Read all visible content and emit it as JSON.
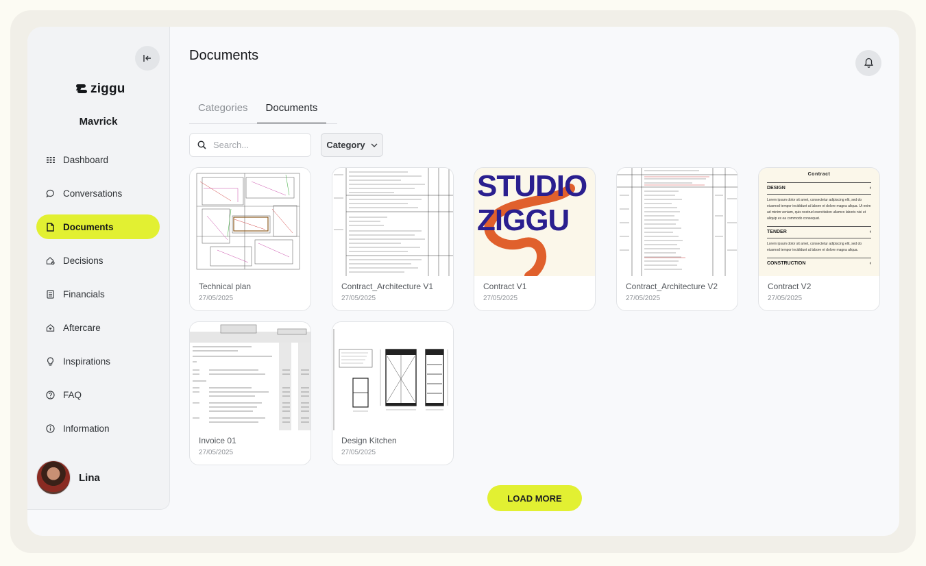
{
  "sidebar": {
    "logo_text": "ziggu",
    "org_name": "Mavrick",
    "items": [
      {
        "label": "Dashboard",
        "icon": "grid-icon"
      },
      {
        "label": "Conversations",
        "icon": "chat-icon"
      },
      {
        "label": "Documents",
        "icon": "document-icon",
        "active": true
      },
      {
        "label": "Decisions",
        "icon": "home-check-icon"
      },
      {
        "label": "Financials",
        "icon": "receipt-icon"
      },
      {
        "label": "Aftercare",
        "icon": "house-heart-icon"
      },
      {
        "label": "Inspirations",
        "icon": "lightbulb-icon"
      },
      {
        "label": "FAQ",
        "icon": "question-icon"
      },
      {
        "label": "Information",
        "icon": "info-icon"
      }
    ],
    "user_name": "Lina"
  },
  "header": {
    "title": "Documents"
  },
  "tabs": [
    {
      "label": "Categories",
      "active": false
    },
    {
      "label": "Documents",
      "active": true
    }
  ],
  "filters": {
    "search_placeholder": "Search...",
    "category_label": "Category"
  },
  "documents": [
    {
      "title": "Technical plan",
      "date": "27/05/2025"
    },
    {
      "title": "Contract_Architecture V1",
      "date": "27/05/2025"
    },
    {
      "title": "Contract V1",
      "date": "27/05/2025",
      "thumb_text": [
        "STUDIO",
        "ZIGGU"
      ]
    },
    {
      "title": "Contract_Architecture V2",
      "date": "27/05/2025"
    },
    {
      "title": "Contract V2",
      "date": "27/05/2025",
      "thumb": {
        "heading": "Contract",
        "sections": [
          "DESIGN",
          "TENDER",
          "CONSTRUCTION"
        ],
        "body": "Lorem ipsum dolor sit amet, consectetur adipiscing elit, sed do eiusmod tempor incididunt ut labore et dolore magna aliqua. Ut enim ad minim veniam, quis nostrud exercitation ullamco laboris nisi ut aliquip ex ea commodo consequat.",
        "body2": "Lorem ipsum dolor sit amet, consectetur adipiscing elit, sed do eiusmod tempor incididunt ut labore et dolore magna aliqua."
      }
    },
    {
      "title": "Invoice 01",
      "date": "27/05/2025"
    },
    {
      "title": "Design Kitchen",
      "date": "27/05/2025"
    }
  ],
  "load_more_label": "LOAD MORE",
  "colors": {
    "accent": "#e2f032",
    "studio_blue": "#2a1f8f",
    "studio_orange": "#e0602c"
  }
}
